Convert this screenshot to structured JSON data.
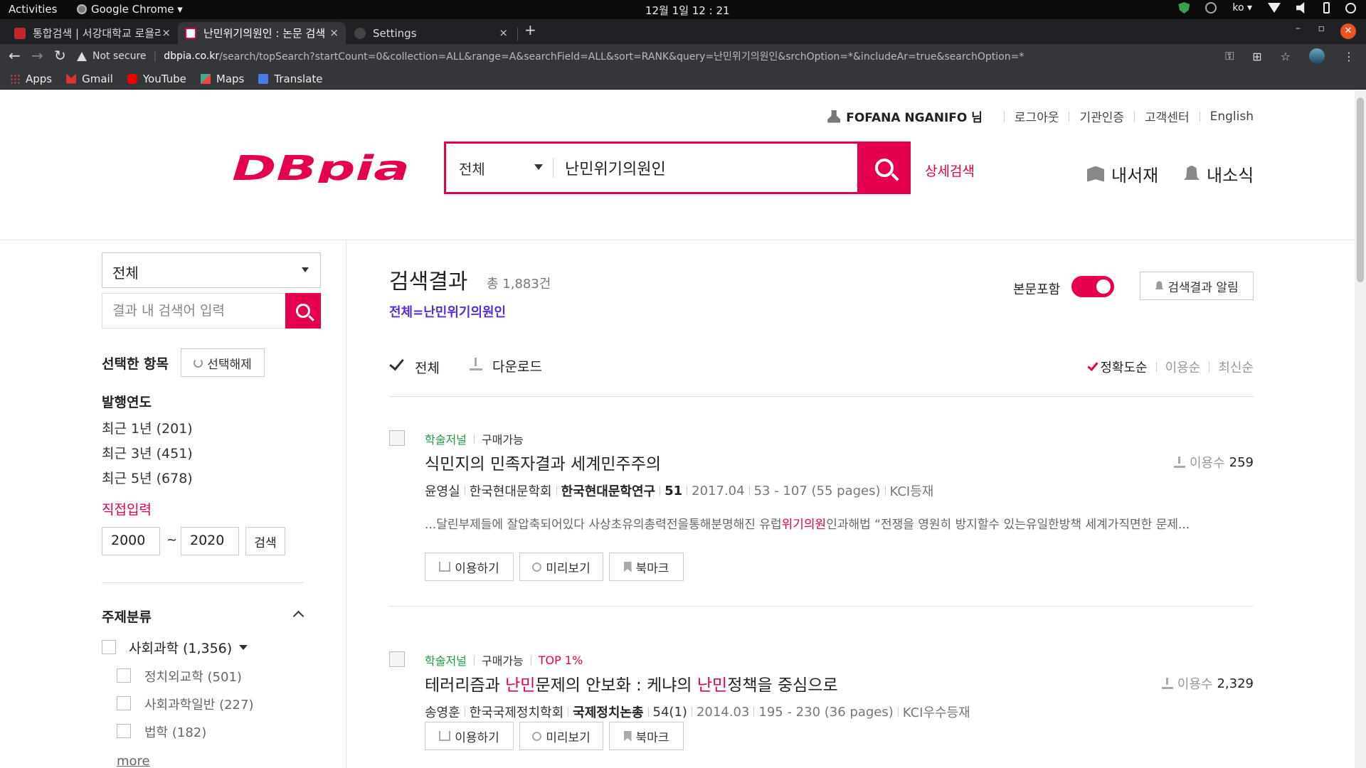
{
  "os": {
    "activities": "Activities",
    "app": "Google Chrome ▾",
    "clock": "12월 1일  12 : 21",
    "lang": "ko ▾"
  },
  "browser": {
    "tabs": [
      {
        "title": "통합검색 | 서강대학교 로욜라",
        "close": "×"
      },
      {
        "title": "난민위기의원인 : 논문 검색",
        "close": "×"
      },
      {
        "title": "Settings",
        "close": "×"
      }
    ],
    "new_tab": "+",
    "not_secure": "Not secure",
    "url_host": "dbpia.co.kr",
    "url_path": "/search/topSearch?startCount=0&collection=ALL&range=A&searchField=ALL&sort=RANK&query=난민위기의원인&srchOption=*&includeAr=true&searchOption=*",
    "bookmarks": [
      "Apps",
      "Gmail",
      "YouTube",
      "Maps",
      "Translate"
    ]
  },
  "header": {
    "user": "FOFANA NGANIFO 님",
    "links": [
      "로그아웃",
      "기관인증",
      "고객센터",
      "English"
    ],
    "logo": "DBpia",
    "scope": "전체",
    "query": "난민위기의원인",
    "advanced": "상세검색",
    "my_library": "내서재",
    "my_news": "내소식",
    "brand_color": "#e5004f"
  },
  "sidebar": {
    "scope": "전체",
    "search_placeholder": "결과 내 검색어 입력",
    "selected_title": "선택한 항목",
    "clear": "선택해제",
    "year_title": "발행연도",
    "years": [
      "최근 1년 (201)",
      "최근 3년 (451)",
      "최근 5년 (678)"
    ],
    "direct": "직접입력",
    "from": "2000",
    "to": "2020",
    "tilde": "~",
    "year_search": "검색",
    "subject_title": "주제분류",
    "category": "사회과학 (1,356)",
    "subcategories": [
      "정치외교학 (501)",
      "사회과학일반 (227)",
      "법학 (182)"
    ],
    "more": "more"
  },
  "results": {
    "title": "검색결과",
    "count": "총 1,883건",
    "query_label": "전체=난민위기의원인",
    "body_include": "본문포함",
    "alert": "검색결과 알림",
    "select_all": "전체",
    "download": "다운로드",
    "sorts": [
      "정확도순",
      "이용순",
      "최신순"
    ],
    "usage_label": "이용수",
    "actions": [
      "이용하기",
      "미리보기",
      "북마크"
    ],
    "items": [
      {
        "type": "학술저널",
        "avail": "구매가능",
        "title": "식민지의 민족자결과 세계민주주의",
        "usage": "259",
        "author": "윤영실",
        "publisher": "한국현대문학회",
        "journal": "한국현대문학연구",
        "volume": "51",
        "date": "2017.04",
        "pages": "53 - 107 (55 pages)",
        "index": "KCI등재",
        "snippet_pre": "...달린부제들에 잘압축되어있다 사상초유의총력전을통해분명해진 유럽",
        "snippet_hl": "위기의원",
        "snippet_post": "인과해법 “전쟁을 영원히 방지할수 있는유일한방책 세계가직면한 문제..."
      },
      {
        "type": "학술저널",
        "avail": "구매가능",
        "badge": "TOP 1%",
        "title_a": "테러리즘과 ",
        "title_hl1": "난민",
        "title_b": "문제의 안보화 : 케냐의 ",
        "title_hl2": "난민",
        "title_c": "정책을 중심으로",
        "usage": "2,329",
        "author": "송영훈",
        "publisher": "한국국제정치학회",
        "journal": "국제정치논총",
        "volume": "54(1)",
        "date": "2014.03",
        "pages": "195 - 230 (36 pages)",
        "index": "KCI우수등재"
      }
    ]
  }
}
